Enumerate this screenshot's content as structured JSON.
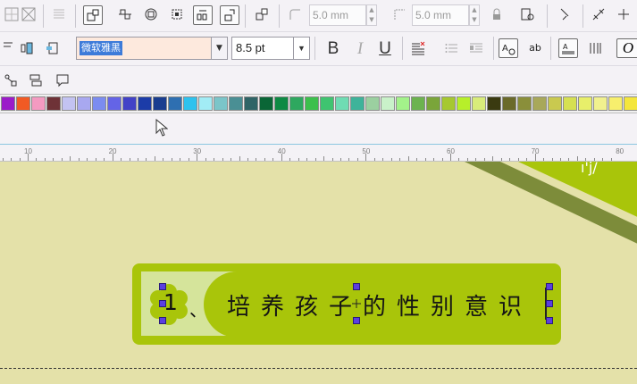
{
  "toolbar1": {
    "width_value": "5.0 mm",
    "height_value": "5.0 mm"
  },
  "toolbar2": {
    "font_name": "微软雅黑",
    "font_size": "8.5 pt",
    "bold_label": "B",
    "italic_label": "I",
    "underline_label": "U",
    "glyph_label": "ab",
    "more_label": "O"
  },
  "palette": {
    "colors": [
      "#9b1bc9",
      "#f15a24",
      "#f49ac1",
      "#6e3237",
      "#c3c3f2",
      "#a8a8f0",
      "#7b8cf0",
      "#6464e6",
      "#4242c7",
      "#1c3ca8",
      "#193d8f",
      "#2e6fb1",
      "#2ec2ee",
      "#a2ecf5",
      "#7bc5c9",
      "#4a8f94",
      "#2f6466",
      "#0a6636",
      "#0e8a44",
      "#2ea85f",
      "#3cc04c",
      "#3fc470",
      "#6fdcb3",
      "#3eb39a",
      "#9bd0a0",
      "#c9f2c9",
      "#a3f28a",
      "#6cb34f",
      "#7aa53a",
      "#a6c830",
      "#b7ef2a",
      "#d8ec7a",
      "#3a3a10",
      "#6a6a2a",
      "#8a8f3a",
      "#a8a85a",
      "#c9c94f",
      "#d6e052",
      "#e8ef6a",
      "#f1f18e",
      "#f7ef6d",
      "#f4e63c"
    ]
  },
  "ruler": {
    "labels": [
      "10",
      "20",
      "30",
      "40",
      "50",
      "60",
      "70",
      "80"
    ]
  },
  "canvas": {
    "item_number": "1",
    "separator": "、",
    "title": "培养孩子的性别意识",
    "accent_color": "#a9c50a",
    "light_color": "#d5e49b",
    "page_color": "#e4e1a9"
  }
}
